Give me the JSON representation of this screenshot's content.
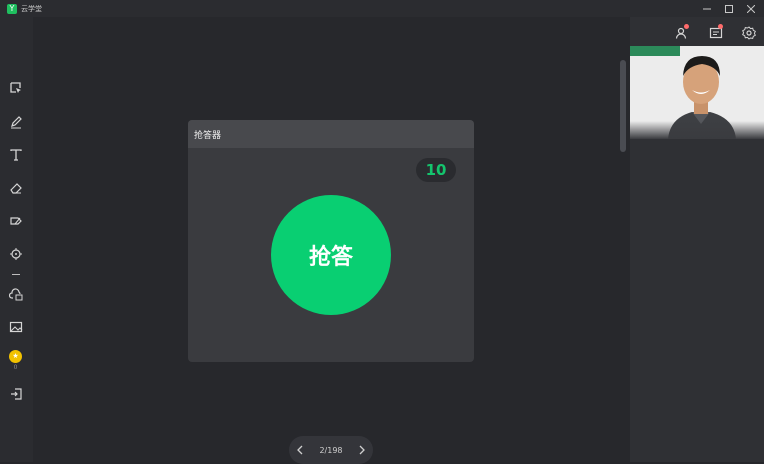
{
  "app": {
    "title": "云学堂"
  },
  "dialog": {
    "title": "抢答器",
    "countdown": "10",
    "button_label": "抢答"
  },
  "pager": {
    "text": "2/198"
  },
  "toolbar": {
    "coin_count": "0"
  },
  "icons": [
    "select-icon",
    "pen-icon",
    "text-icon",
    "eraser-icon",
    "tag-icon",
    "laser-pointer-icon",
    "cloud-upload-icon",
    "image-icon",
    "coin-icon",
    "exit-icon",
    "user-icon",
    "message-icon",
    "settings-icon"
  ],
  "colors": {
    "accent": "#09cf72",
    "countdown": "#14c46d",
    "badge": "#ff6b6b",
    "coin": "#f2c200"
  }
}
